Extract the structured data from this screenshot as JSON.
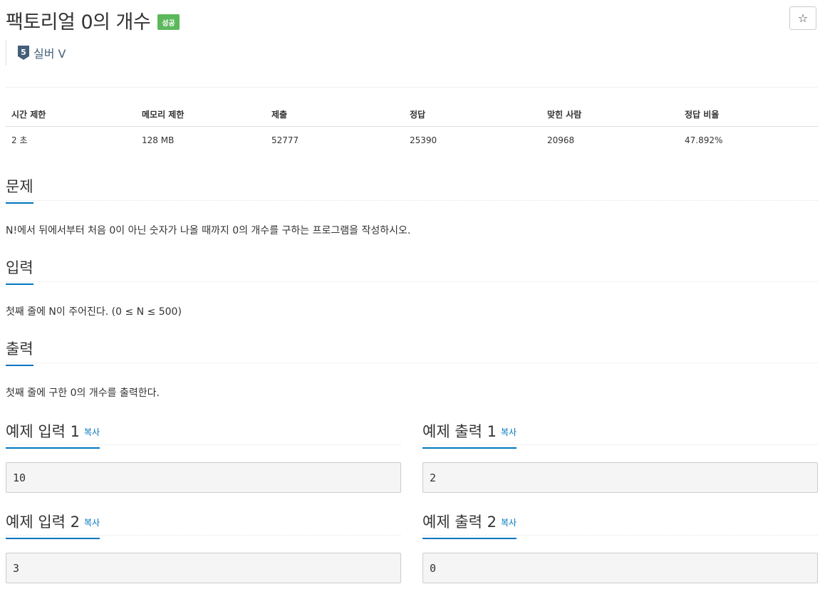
{
  "problem": {
    "title": "팩토리얼 0의 개수",
    "status_badge": "성공",
    "star": "☆",
    "tier_label": "실버 V",
    "tier_number": "5",
    "tier_color": "#435f7a"
  },
  "info_table": {
    "headers": [
      "시간 제한",
      "메모리 제한",
      "제출",
      "정답",
      "맞힌 사람",
      "정답 비율"
    ],
    "values": [
      "2 초",
      "128 MB",
      "52777",
      "25390",
      "20968",
      "47.892%"
    ]
  },
  "sections": {
    "description": {
      "heading": "문제",
      "text": "N!에서 뒤에서부터 처음 0이 아닌 숫자가 나올 때까지 0의 개수를 구하는 프로그램을 작성하시오."
    },
    "input": {
      "heading": "입력",
      "text": "첫째 줄에 N이 주어진다. (0 ≤ N ≤ 500)"
    },
    "output": {
      "heading": "출력",
      "text": "첫째 줄에 구한 0의 개수를 출력한다."
    }
  },
  "samples": {
    "copy_label": "복사",
    "input1": {
      "heading": "예제 입력 1",
      "value": "10"
    },
    "output1": {
      "heading": "예제 출력 1",
      "value": "2"
    },
    "input2": {
      "heading": "예제 입력 2",
      "value": "3"
    },
    "output2": {
      "heading": "예제 출력 2",
      "value": "0"
    }
  },
  "colors": {
    "accent": "#0076c0",
    "success": "#5cb85c"
  }
}
